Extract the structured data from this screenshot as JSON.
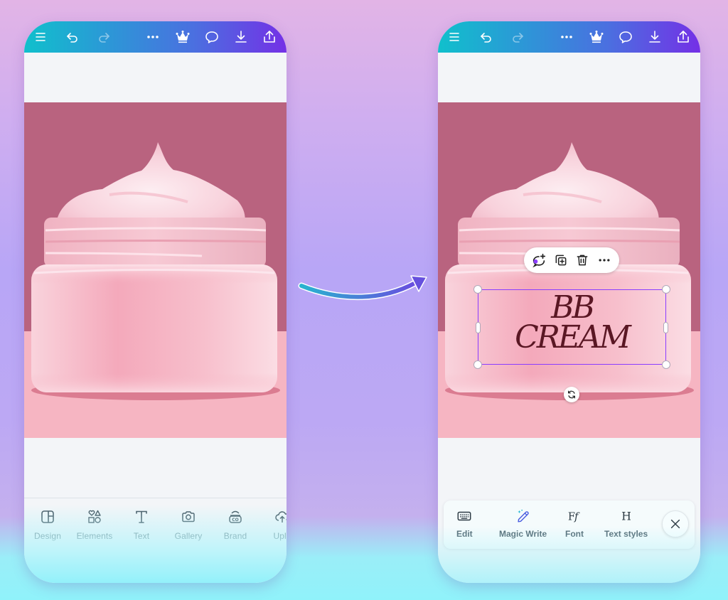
{
  "topbar": {
    "icons": [
      "menu-icon",
      "undo-icon",
      "redo-icon",
      "more-icon",
      "crown-icon",
      "comment-icon",
      "download-icon",
      "share-icon"
    ]
  },
  "left_phone": {
    "bottom_nav": [
      {
        "label": "Design",
        "icon": "design-icon"
      },
      {
        "label": "Elements",
        "icon": "elements-icon"
      },
      {
        "label": "Text",
        "icon": "text-icon"
      },
      {
        "label": "Gallery",
        "icon": "camera-icon"
      },
      {
        "label": "Brand",
        "icon": "brand-icon"
      },
      {
        "label": "Uplo",
        "icon": "upload-icon"
      }
    ]
  },
  "right_phone": {
    "text_element": {
      "line1": "BB",
      "line2": "CREAM",
      "color": "#5a1724"
    },
    "context_menu": [
      "magic-comment-icon",
      "duplicate-icon",
      "trash-icon",
      "more-icon"
    ],
    "text_toolbar": [
      {
        "label": "Edit",
        "icon": "keyboard-icon"
      },
      {
        "label": "Magic Write",
        "icon": "magic-pen-icon"
      },
      {
        "label": "Font",
        "icon": "font-icon"
      },
      {
        "label": "Text styles",
        "icon": "heading-icon"
      }
    ],
    "close_icon": "close-icon"
  },
  "colors": {
    "selection": "#8b3dff",
    "topbar_start": "#10c0cc",
    "topbar_end": "#7430e6",
    "nav_text": "#4f6570"
  }
}
